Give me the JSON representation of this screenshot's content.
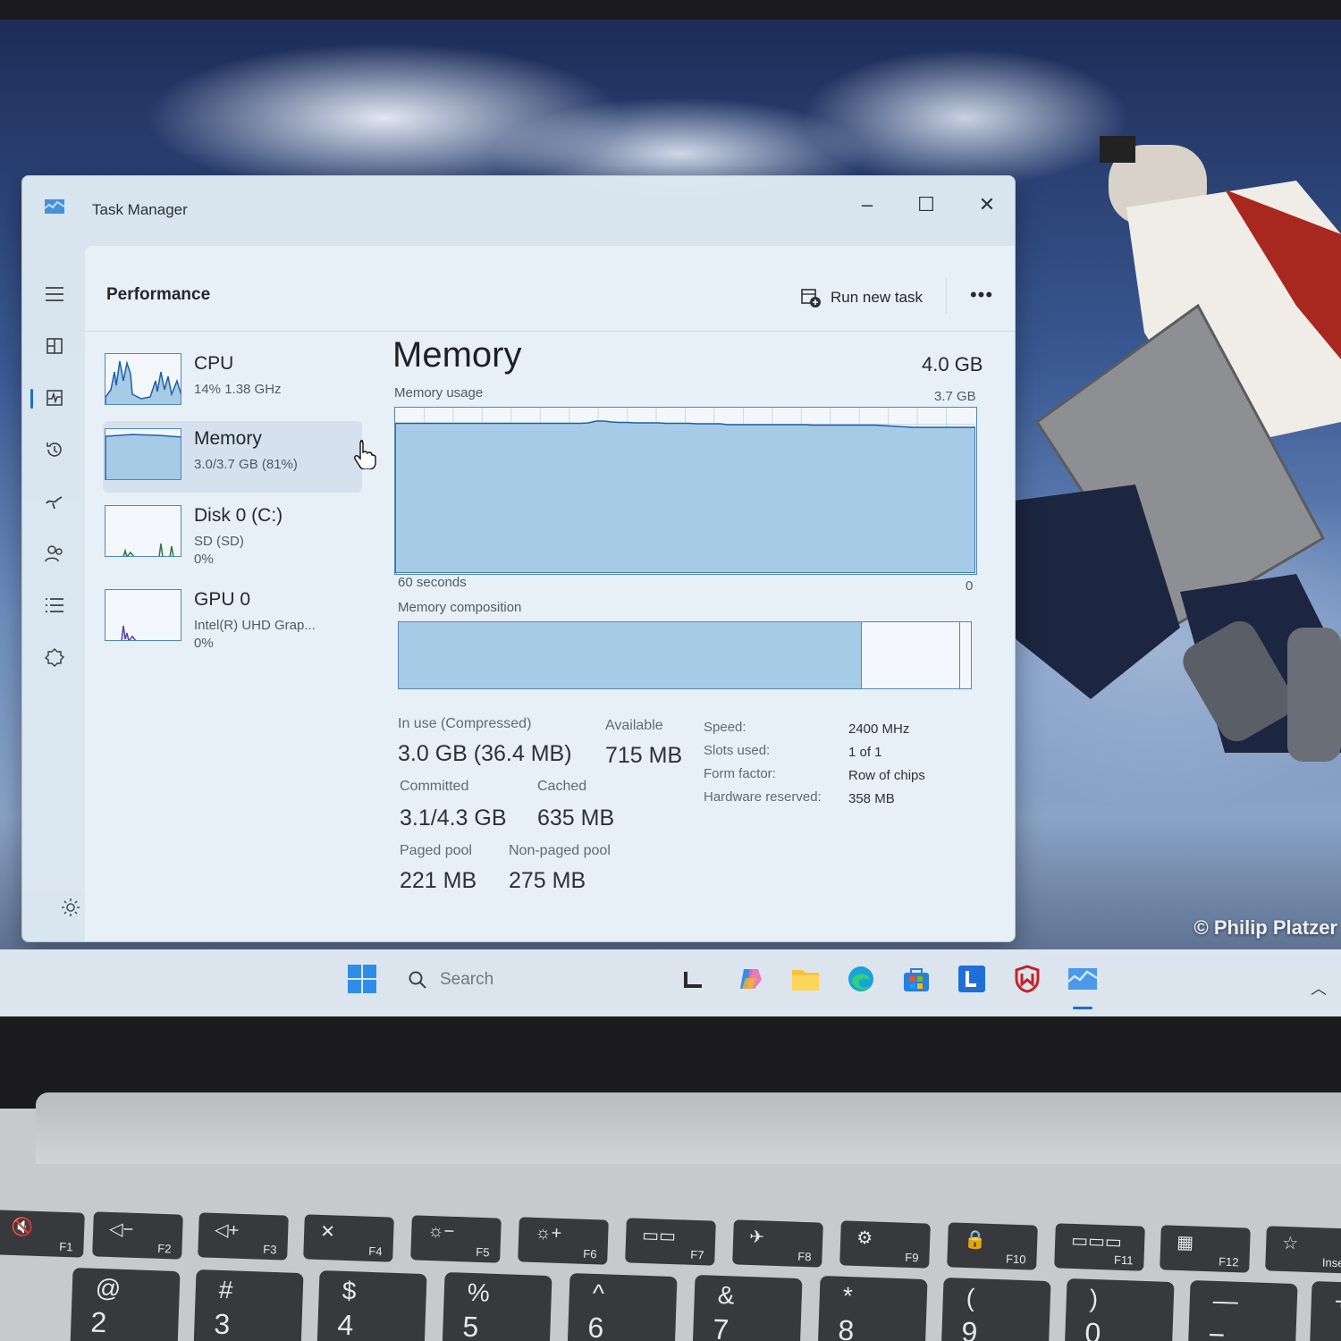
{
  "window": {
    "title": "Task Manager",
    "minimize_glyph": "–",
    "maximize_glyph": "☐",
    "close_glyph": "✕"
  },
  "header": {
    "page": "Performance",
    "run_new_task": "Run new task",
    "more": "•••"
  },
  "rail": {
    "icons": [
      "hamburger-menu-icon",
      "processes-icon",
      "performance-icon",
      "app-history-icon",
      "startup-apps-icon",
      "users-icon",
      "details-icon",
      "services-icon",
      "settings-icon"
    ],
    "active": "performance-icon"
  },
  "devices": [
    {
      "name": "CPU",
      "line1": "14%  1.38 GHz",
      "line2": ""
    },
    {
      "name": "Memory",
      "line1": "3.0/3.7 GB (81%)",
      "line2": ""
    },
    {
      "name": "Disk 0 (C:)",
      "line1": "SD (SD)",
      "line2": "0%"
    },
    {
      "name": "GPU 0",
      "line1": "Intel(R) UHD Grap...",
      "line2": "0%"
    }
  ],
  "selected_device": "Memory",
  "memory": {
    "title": "Memory",
    "total": "4.0 GB",
    "usage_label": "Memory usage",
    "usage_max": "3.7 GB",
    "time_left": "60 seconds",
    "time_right": "0",
    "composition_label": "Memory composition",
    "composition_in_use_fraction": 0.81,
    "composition_modified_fraction": 0.17,
    "usage_history_gb": [
      3.35,
      3.35,
      3.35,
      3.35,
      3.35,
      3.35,
      3.35,
      3.35,
      3.35,
      3.35,
      3.35,
      3.35,
      3.35,
      3.35,
      3.35,
      3.35,
      3.35,
      3.35,
      3.35,
      3.35,
      3.35,
      3.35,
      3.35,
      3.35,
      3.35,
      3.36,
      3.4,
      3.4,
      3.38,
      3.37,
      3.37,
      3.36,
      3.36,
      3.36,
      3.36,
      3.35,
      3.35,
      3.35,
      3.35,
      3.34,
      3.34,
      3.34,
      3.34,
      3.32,
      3.32,
      3.32,
      3.32,
      3.32,
      3.32,
      3.32,
      3.32,
      3.32,
      3.32,
      3.32,
      3.31,
      3.31,
      3.31,
      3.31,
      3.31,
      3.31,
      3.31,
      3.31,
      3.31,
      3.3,
      3.29,
      3.28,
      3.27,
      3.26,
      3.26,
      3.26,
      3.26,
      3.26,
      3.26,
      3.26,
      3.26,
      3.26
    ],
    "stats": {
      "in_use_label": "In use (Compressed)",
      "in_use_value": "3.0 GB (36.4 MB)",
      "available_label": "Available",
      "available_value": "715 MB",
      "committed_label": "Committed",
      "committed_value": "3.1/4.3 GB",
      "cached_label": "Cached",
      "cached_value": "635 MB",
      "paged_label": "Paged pool",
      "paged_value": "221 MB",
      "nonpaged_label": "Non-paged pool",
      "nonpaged_value": "275 MB"
    },
    "specs": {
      "speed_label": "Speed:",
      "speed_value": "2400 MHz",
      "slots_label": "Slots used:",
      "slots_value": "1 of 1",
      "form_label": "Form factor:",
      "form_value": "Row of chips",
      "hw_label": "Hardware reserved:",
      "hw_value": "358 MB"
    }
  },
  "taskbar": {
    "search_placeholder": "Search",
    "apps": [
      "start-icon",
      "widgets-icon",
      "copilot-icon",
      "file-explorer-icon",
      "edge-icon",
      "store-icon",
      "lenovo-app-icon",
      "mcafee-icon",
      "task-manager-icon"
    ],
    "active_app": "task-manager-icon"
  },
  "wallpaper": {
    "credit": "© Philip Platzer"
  },
  "keyboard": {
    "fkeys": [
      {
        "sym": "🔇",
        "label": "F1"
      },
      {
        "sym": "◁−",
        "label": "F2"
      },
      {
        "sym": "◁+",
        "label": "F3"
      },
      {
        "sym": "✕",
        "label": "F4"
      },
      {
        "sym": "☼−",
        "label": "F5"
      },
      {
        "sym": "☼+",
        "label": "F6"
      },
      {
        "sym": "▭▭",
        "label": "F7"
      },
      {
        "sym": "✈",
        "label": "F8"
      },
      {
        "sym": "⚙",
        "label": "F9"
      },
      {
        "sym": "🔒",
        "label": "F10"
      },
      {
        "sym": "▭▭▭",
        "label": "F11"
      },
      {
        "sym": "▦",
        "label": "F12"
      },
      {
        "sym": "☆",
        "label": "Inse"
      }
    ],
    "numkeys": [
      {
        "up": "@",
        "dn": "2"
      },
      {
        "up": "#",
        "dn": "3"
      },
      {
        "up": "$",
        "dn": "4"
      },
      {
        "up": "%",
        "dn": "5"
      },
      {
        "up": "^",
        "dn": "6"
      },
      {
        "up": "&",
        "dn": "7"
      },
      {
        "up": "*",
        "dn": "8"
      },
      {
        "up": "(",
        "dn": "9"
      },
      {
        "up": ")",
        "dn": "0"
      },
      {
        "up": "—",
        "dn": "−"
      },
      {
        "up": "+",
        "dn": ""
      }
    ]
  },
  "colors": {
    "graph_fill": "#a6cbe6",
    "graph_border": "#4f86bf",
    "accent": "#1f6fc4"
  }
}
